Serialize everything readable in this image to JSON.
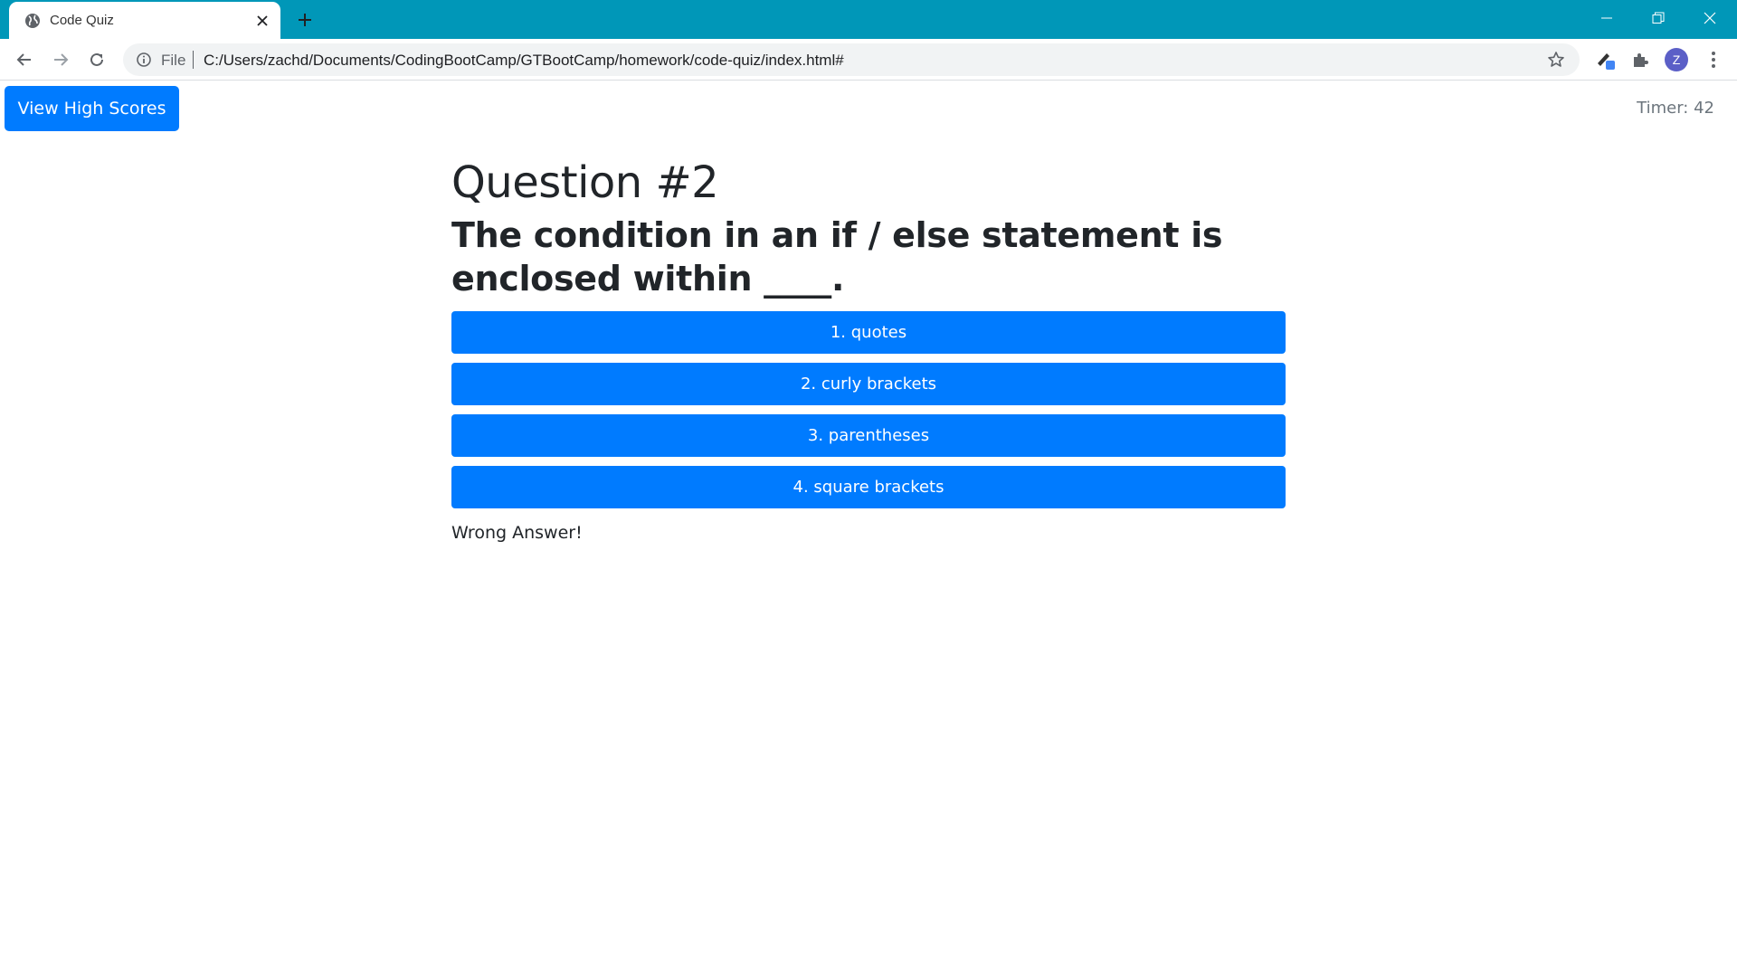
{
  "browser": {
    "tab_title": "Code Quiz",
    "url_scheme": "File",
    "url": "C:/Users/zachd/Documents/CodingBootCamp/GTBootCamp/homework/code-quiz/index.html#",
    "avatar_letter": "Z",
    "colors": {
      "tabstrip": "#0097b8",
      "omnibox": "#f1f3f4"
    }
  },
  "page": {
    "high_scores_label": "View High Scores",
    "timer": "Timer: 42",
    "question_number": "Question #2",
    "question_text": "The condition in an if / else statement is enclosed within ____.",
    "answers": [
      "1. quotes",
      "2. curly brackets",
      "3. parentheses",
      "4. square brackets"
    ],
    "feedback": "Wrong Answer!",
    "colors": {
      "primary": "#007bff",
      "text": "#212529",
      "muted": "#6c757d"
    }
  }
}
